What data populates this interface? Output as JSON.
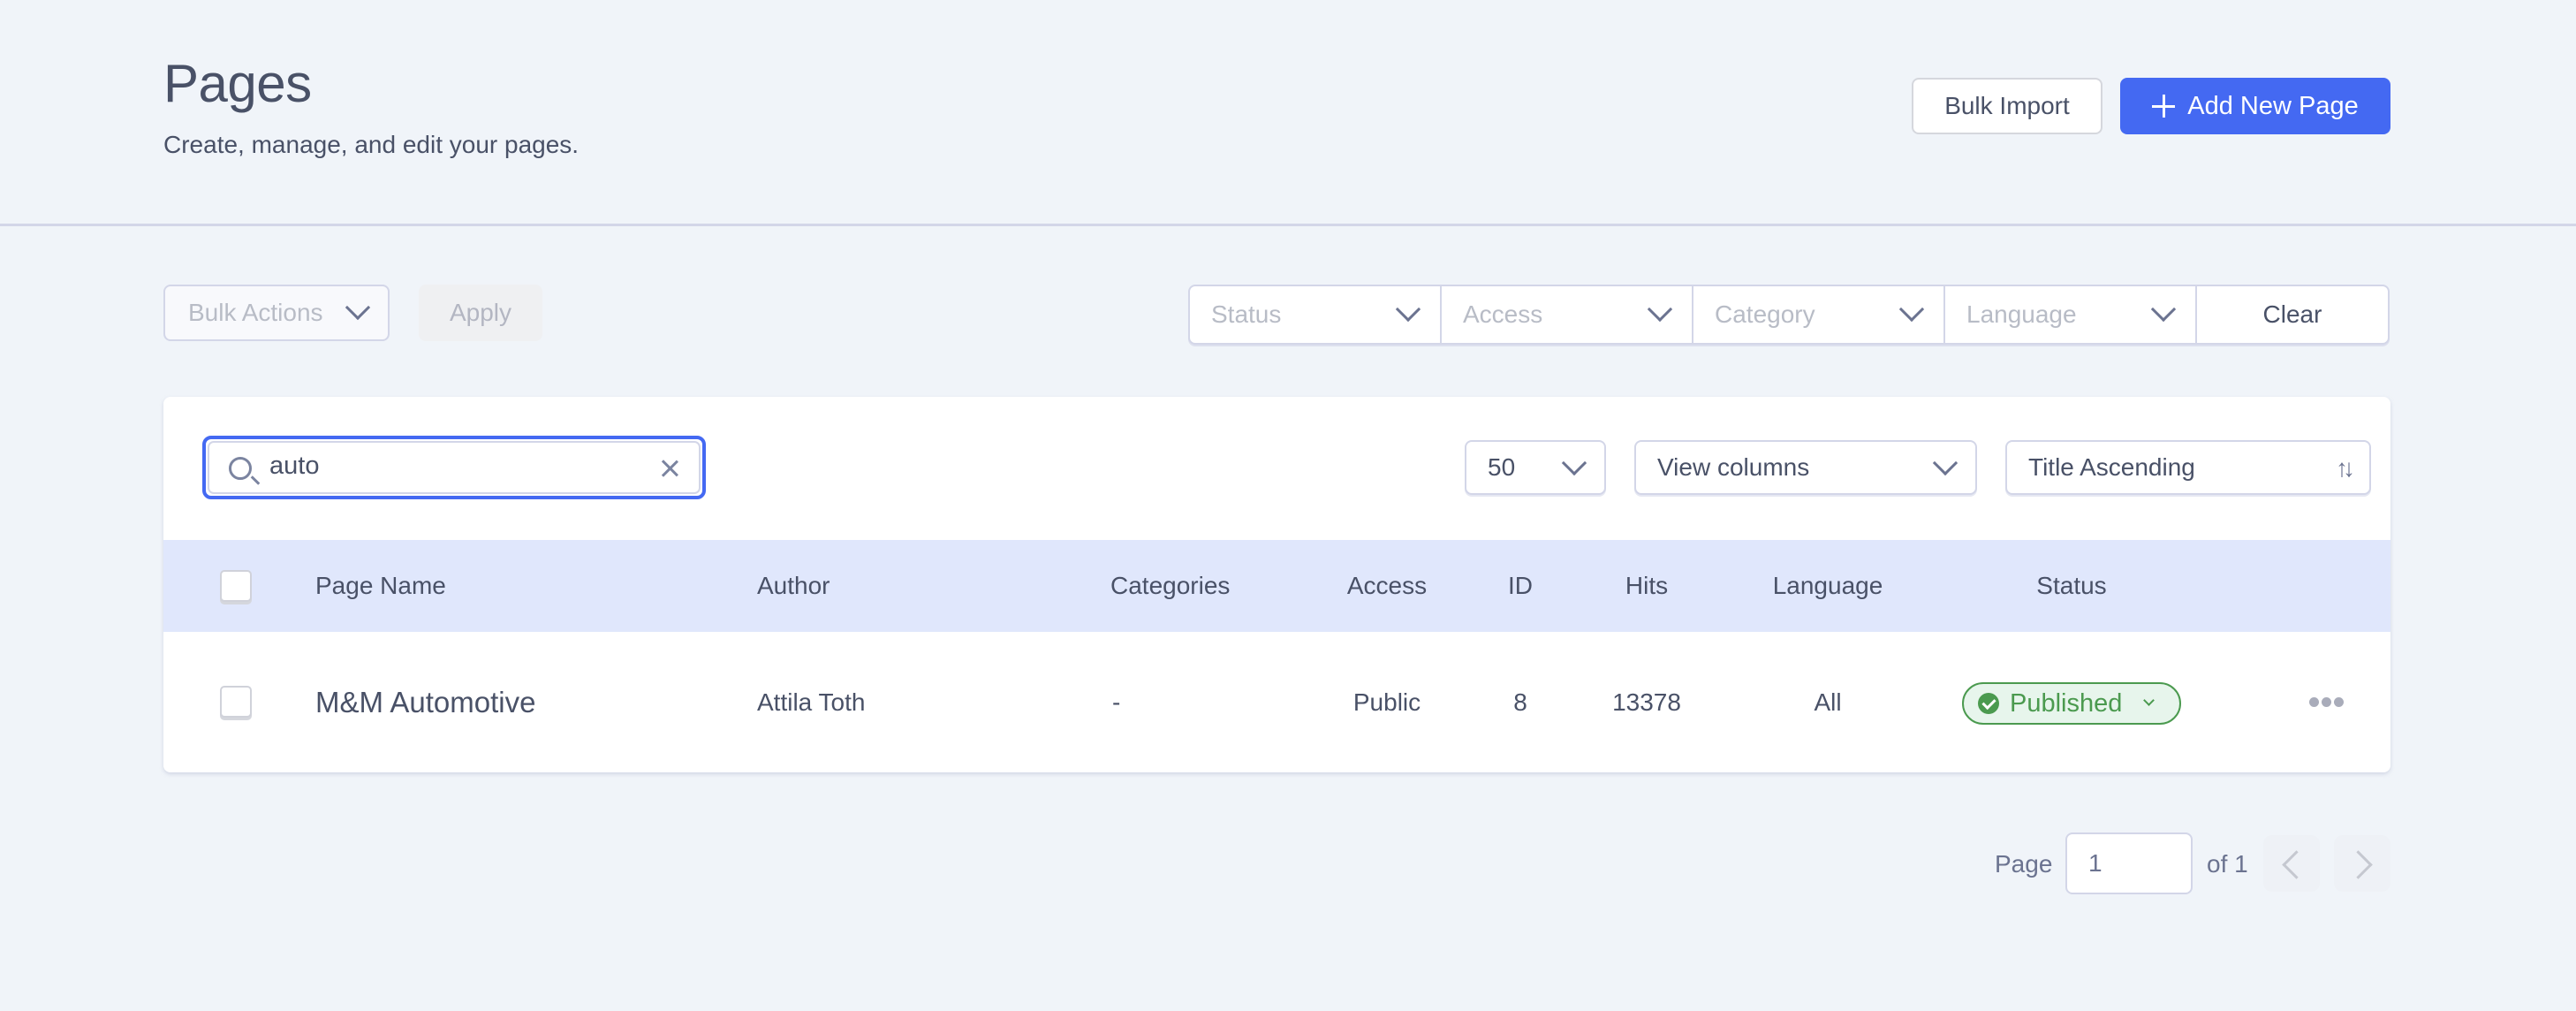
{
  "header": {
    "title": "Pages",
    "subtitle": "Create, manage, and edit your pages.",
    "bulk_import_label": "Bulk Import",
    "add_new_label": "Add New Page"
  },
  "toolbar": {
    "bulk_actions_placeholder": "Bulk Actions",
    "apply_label": "Apply",
    "filters": [
      {
        "placeholder": "Status"
      },
      {
        "placeholder": "Access"
      },
      {
        "placeholder": "Category"
      },
      {
        "placeholder": "Language"
      }
    ],
    "clear_label": "Clear"
  },
  "list_controls": {
    "search_value": "auto",
    "per_page": "50",
    "view_columns_label": "View columns",
    "sort_label": "Title Ascending"
  },
  "table": {
    "columns": [
      "Page Name",
      "Author",
      "Categories",
      "Access",
      "ID",
      "Hits",
      "Language",
      "Status"
    ],
    "rows": [
      {
        "page_name": "M&M Automotive",
        "author": "Attila Toth",
        "categories": "-",
        "access": "Public",
        "id": "8",
        "hits": "13378",
        "language": "All",
        "status": "Published"
      }
    ]
  },
  "pagination": {
    "page_label": "Page",
    "current_page": "1",
    "of_label": "of 1"
  },
  "colors": {
    "accent": "#4469f2",
    "status_published": "#4b9a4f",
    "table_header_bg": "#e0e7fc",
    "page_bg": "#f0f4f9"
  }
}
